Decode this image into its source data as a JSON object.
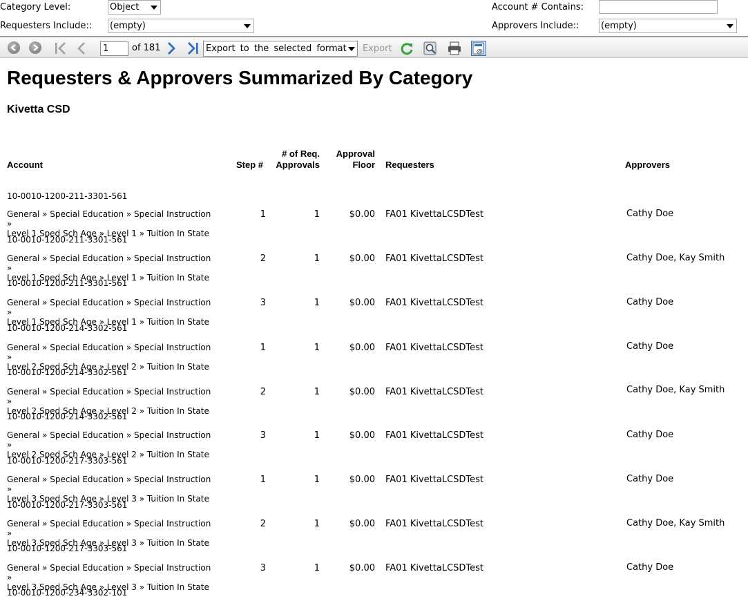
{
  "params": {
    "category_level_label": "Category Level:",
    "category_level_value": "Object",
    "requesters_label": "Requesters Include::",
    "requesters_value": "(empty)",
    "account_contains_label": "Account # Contains:",
    "account_contains_value": "",
    "approvers_label": "Approvers Include::",
    "approvers_value": "(empty)"
  },
  "toolbar": {
    "page": "1",
    "of_pages": "of 181",
    "export_format": "Export to the selected format",
    "export_label": "Export"
  },
  "report": {
    "title": "Requesters & Approvers Summarized By Category",
    "subtitle": "Kivetta CSD",
    "headers": {
      "account": "Account",
      "step_line1": "",
      "step_line2": "Step #",
      "req_line1": "# of Req.",
      "req_line2": "Approvals",
      "floor_line1": "Approval",
      "floor_line2": "Floor",
      "requesters": "Requesters",
      "approvers": "Approvers"
    },
    "rows": [
      {
        "account": "10-0010-1200-211-3301-561",
        "cat1": "General » Special Education » Special Instruction »",
        "cat2": "Level 1 Sped Sch Age » Level 1 » Tuition In State",
        "step": "1",
        "approvals": "1",
        "floor": "$0.00",
        "requesters": "FA01 KivettaLCSDTest",
        "approvers": "Cathy Doe"
      },
      {
        "account": "10-0010-1200-211-3301-561",
        "cat1": "General » Special Education » Special Instruction »",
        "cat2": "Level 1 Sped Sch Age » Level 1 » Tuition In State",
        "step": "2",
        "approvals": "1",
        "floor": "$0.00",
        "requesters": "FA01 KivettaLCSDTest",
        "approvers": "Cathy Doe, Kay Smith"
      },
      {
        "account": "10-0010-1200-211-3301-561",
        "cat1": "General » Special Education » Special Instruction »",
        "cat2": "Level 1 Sped Sch Age » Level 1 » Tuition In State",
        "step": "3",
        "approvals": "1",
        "floor": "$0.00",
        "requesters": "FA01 KivettaLCSDTest",
        "approvers": "Cathy Doe"
      },
      {
        "account": "10-0010-1200-214-3302-561",
        "cat1": "General » Special Education » Special Instruction »",
        "cat2": "Level 2 Sped Sch Age » Level 2 » Tuition In State",
        "step": "1",
        "approvals": "1",
        "floor": "$0.00",
        "requesters": "FA01 KivettaLCSDTest",
        "approvers": "Cathy Doe"
      },
      {
        "account": "10-0010-1200-214-3302-561",
        "cat1": "General » Special Education » Special Instruction »",
        "cat2": "Level 2 Sped Sch Age » Level 2 » Tuition In State",
        "step": "2",
        "approvals": "1",
        "floor": "$0.00",
        "requesters": "FA01 KivettaLCSDTest",
        "approvers": "Cathy Doe, Kay Smith"
      },
      {
        "account": "10-0010-1200-214-3302-561",
        "cat1": "General » Special Education » Special Instruction »",
        "cat2": "Level 2 Sped Sch Age » Level 2 » Tuition In State",
        "step": "3",
        "approvals": "1",
        "floor": "$0.00",
        "requesters": "FA01 KivettaLCSDTest",
        "approvers": "Cathy Doe"
      },
      {
        "account": "10-0010-1200-217-3303-561",
        "cat1": "General » Special Education » Special Instruction »",
        "cat2": "Level 3 Sped Sch Age » Level 3 » Tuition In State",
        "step": "1",
        "approvals": "1",
        "floor": "$0.00",
        "requesters": "FA01 KivettaLCSDTest",
        "approvers": "Cathy Doe"
      },
      {
        "account": "10-0010-1200-217-3303-561",
        "cat1": "General » Special Education » Special Instruction »",
        "cat2": "Level 3 Sped Sch Age » Level 3 » Tuition In State",
        "step": "2",
        "approvals": "1",
        "floor": "$0.00",
        "requesters": "FA01 KivettaLCSDTest",
        "approvers": "Cathy Doe, Kay Smith"
      },
      {
        "account": "10-0010-1200-217-3303-561",
        "cat1": "General » Special Education » Special Instruction »",
        "cat2": "Level 3 Sped Sch Age » Level 3 » Tuition In State",
        "step": "3",
        "approvals": "1",
        "floor": "$0.00",
        "requesters": "FA01 KivettaLCSDTest",
        "approvers": "Cathy Doe"
      }
    ],
    "next_account": "10-0010-1200-234-3302-101"
  }
}
